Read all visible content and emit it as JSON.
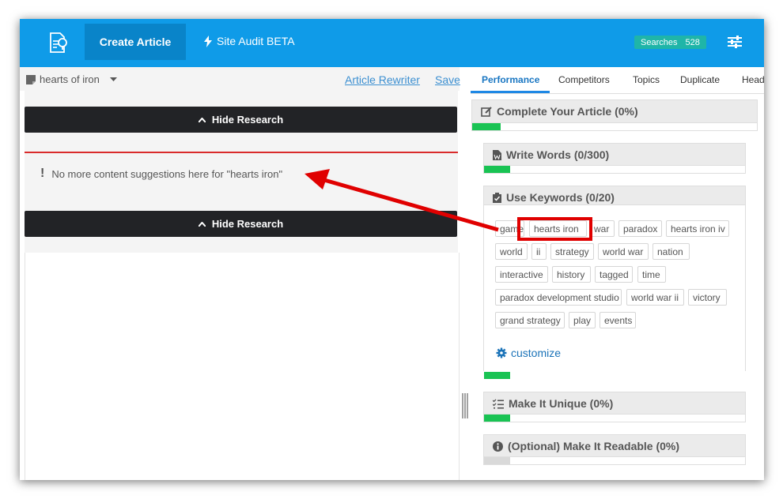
{
  "header": {
    "create_article": "Create Article",
    "site_audit": "Site Audit BETA",
    "searches_label": "Searches",
    "searches_count": "528"
  },
  "toolbar": {
    "doc_name": "hearts of iron",
    "article_rewriter": "Article Rewriter",
    "save": "Save"
  },
  "research": {
    "hide_label": "Hide Research",
    "message": "No more content suggestions here for \"hearts iron\""
  },
  "tabs": [
    "Performance",
    "Competitors",
    "Topics",
    "Duplicate",
    "Head"
  ],
  "sections": {
    "complete": {
      "title": "Complete Your Article (0%)",
      "progress": 0.1
    },
    "write_words": {
      "title": "Write Words (0/300)",
      "progress": 0.1
    },
    "use_keywords": {
      "title": "Use Keywords (0/20)",
      "progress": 0.1
    },
    "unique": {
      "title": "Make It Unique (0%)",
      "progress": 0.1
    },
    "readable": {
      "title": "(Optional) Make It Readable (0%)",
      "progress": 0.1
    }
  },
  "keywords": [
    "game",
    "hearts iron",
    "war",
    "paradox",
    "hearts iron iv",
    "world",
    "ii",
    "strategy",
    "world war",
    "nation",
    "interactive",
    "history",
    "tagged",
    "time",
    "paradox development studio",
    "world war ii",
    "victory",
    "grand strategy",
    "play",
    "events"
  ],
  "customize_label": "customize",
  "colors": {
    "topbar": "#0f9be8",
    "active_button": "#0984c9",
    "progress_green": "#19c353",
    "annotation_red": "#e00000",
    "link_blue": "#3b8fd1"
  }
}
